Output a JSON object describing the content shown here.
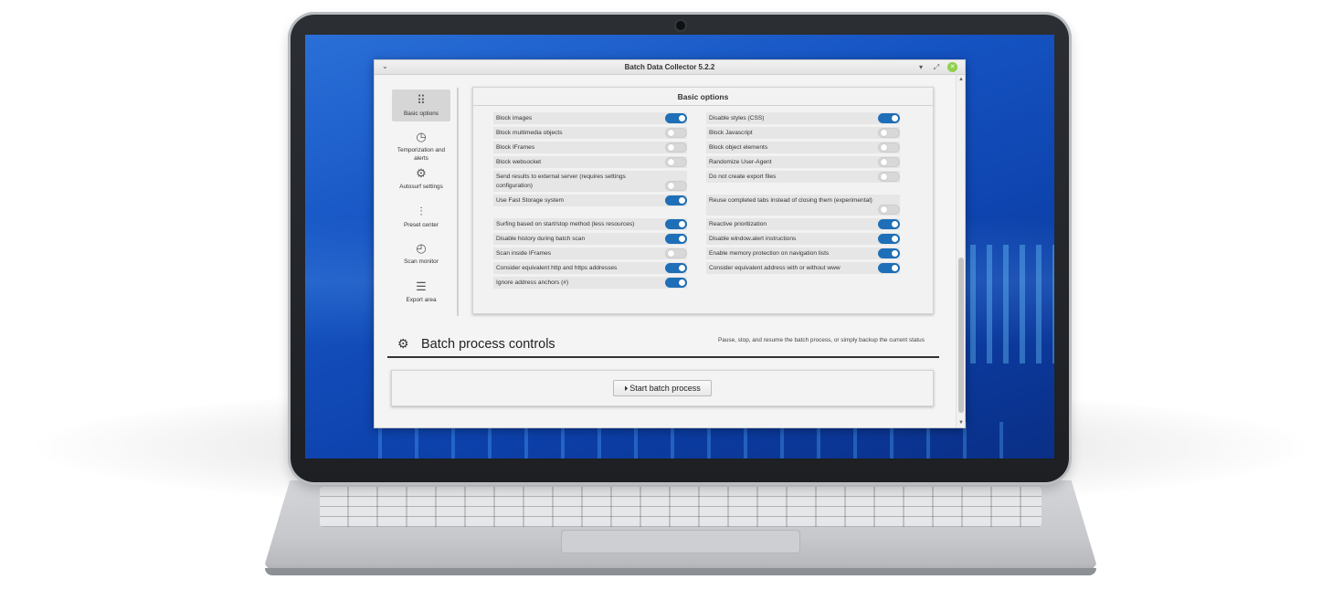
{
  "window": {
    "title": "Batch Data Collector 5.2.2",
    "menu_icon": "chevron-down",
    "min_icon": "minimize",
    "max_icon": "maximize",
    "close_icon": "close"
  },
  "sidebar": {
    "items": [
      {
        "label": "Basic options",
        "icon": "grid-icon",
        "glyph": "⠿",
        "active": true
      },
      {
        "label": "Temporization and alerts",
        "icon": "timer-icon",
        "glyph": "◷",
        "active": false
      },
      {
        "label": "Autosurf settings",
        "icon": "gear-icon",
        "glyph": "⚙",
        "active": false
      },
      {
        "label": "Preset center",
        "icon": "sliders-icon",
        "glyph": "⫶",
        "active": false
      },
      {
        "label": "Scan monitor",
        "icon": "gauge-icon",
        "glyph": "◴",
        "active": false
      },
      {
        "label": "Export area",
        "icon": "export-icon",
        "glyph": "☰",
        "active": false
      }
    ]
  },
  "basic_options": {
    "title": "Basic options",
    "left": [
      {
        "label": "Block images",
        "on": true
      },
      {
        "label": "Block multimedia objects",
        "on": false
      },
      {
        "label": "Block IFrames",
        "on": false
      },
      {
        "label": "Block websocket",
        "on": false
      },
      {
        "label": "Send results to external server (requires settings configuration)",
        "on": false
      },
      {
        "label": "Use Fast Storage system",
        "on": true
      },
      {
        "label": "Surfing based on start/stop method (less resources)",
        "on": true
      },
      {
        "label": "Disable history during batch scan",
        "on": true
      },
      {
        "label": "Scan inside IFrames",
        "on": false
      },
      {
        "label": "Consider equivalent http and https addresses",
        "on": true
      },
      {
        "label": "Ignore address anchors (#)",
        "on": true
      }
    ],
    "right": [
      {
        "label": "Disable styles (CSS)",
        "on": true
      },
      {
        "label": "Block Javascript",
        "on": false
      },
      {
        "label": "Block object elements",
        "on": false
      },
      {
        "label": "Randomize User-Agent",
        "on": false
      },
      {
        "label": "Do not create export files",
        "on": false
      },
      {
        "label": "Reuse completed tabs instead of closing them (experimental)",
        "on": false
      },
      {
        "label": "Reactive prioritization",
        "on": true
      },
      {
        "label": "Disable window.alert instructions",
        "on": true
      },
      {
        "label": "Enable memory protection on navigation lists",
        "on": true
      },
      {
        "label": "Consider equivalent address with or without www",
        "on": true
      }
    ]
  },
  "batch_controls": {
    "title": "Batch process controls",
    "description": "Pause, stop, and resume the batch process, or simply backup the current status",
    "start_label": "Start batch process"
  },
  "colors": {
    "toggle_on": "#1e6fb8",
    "toggle_off": "#d8d8d8",
    "desktop": "#1553c2"
  }
}
